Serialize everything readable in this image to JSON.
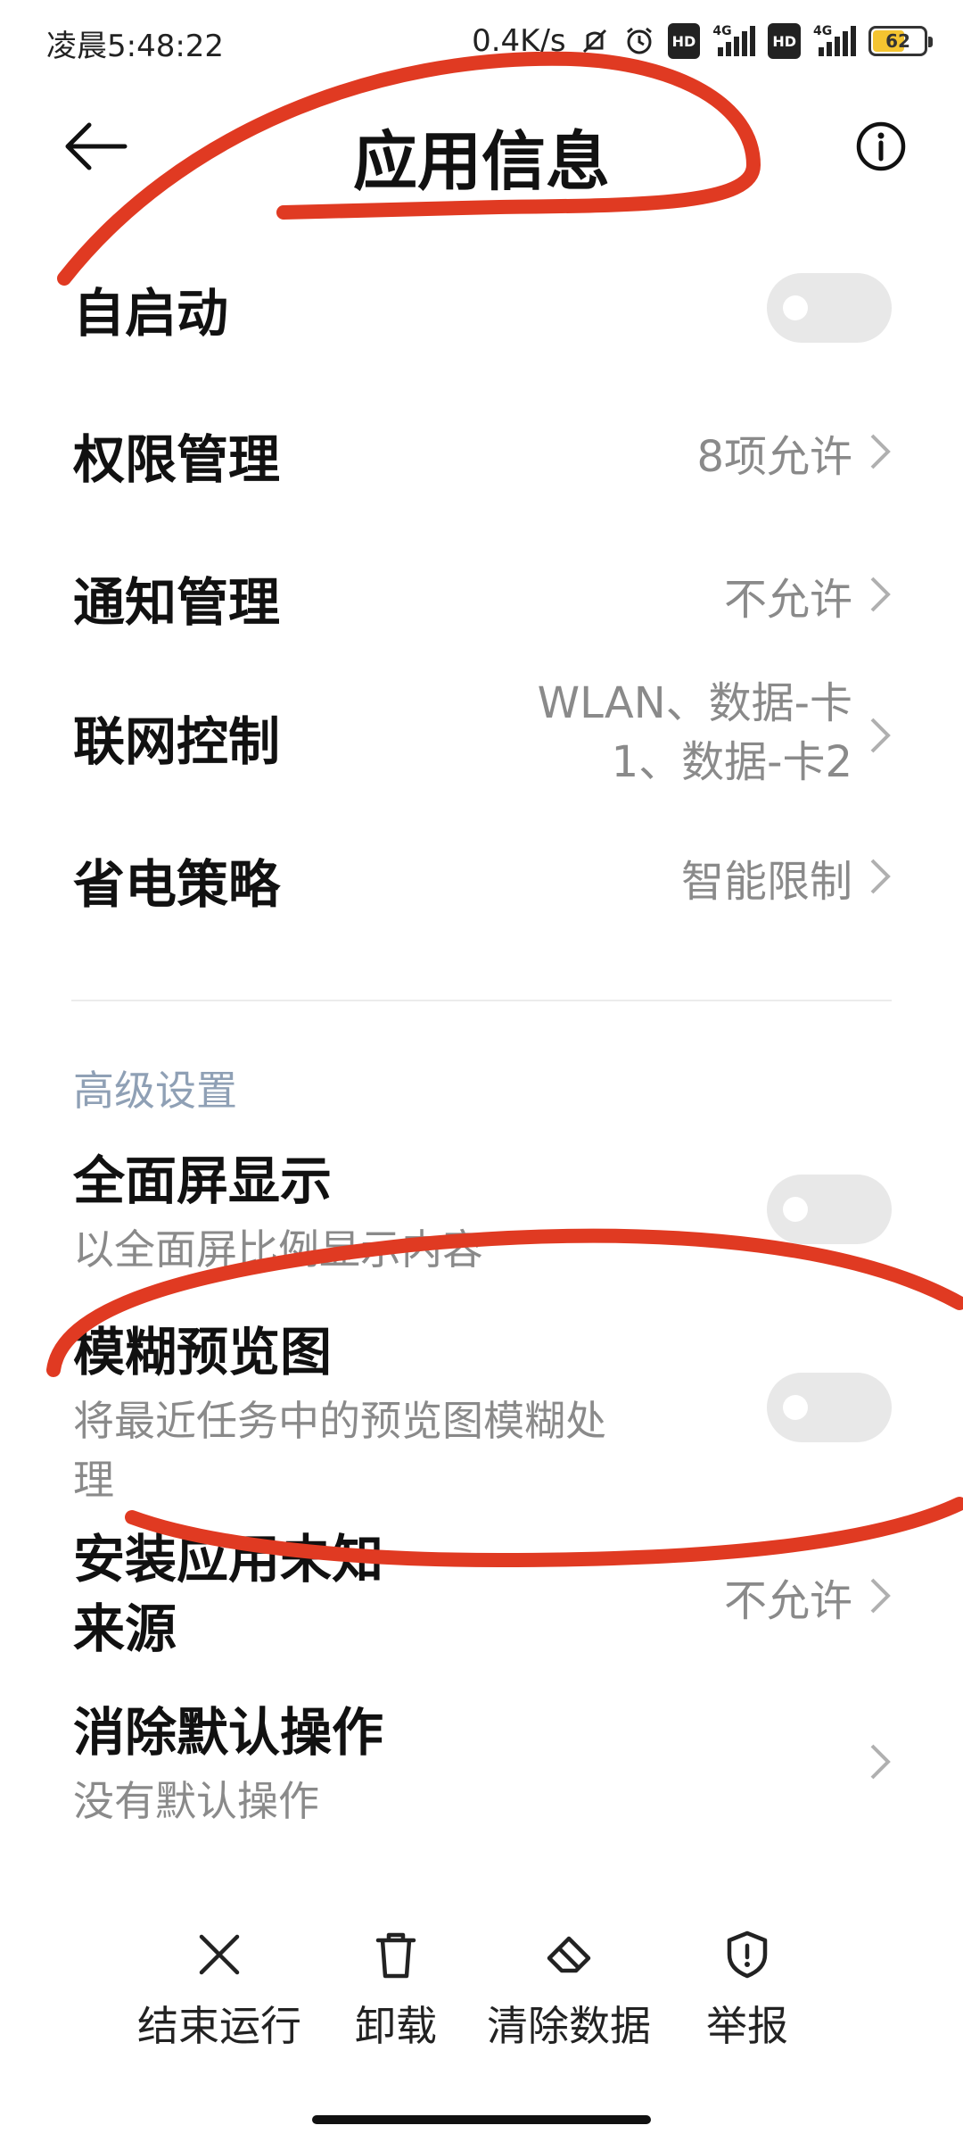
{
  "status_bar": {
    "time": "凌晨5:48:22",
    "net_speed": "0.4K/s",
    "signal_label_1": "4G",
    "signal_label_2": "4G",
    "hd_label": "HD",
    "battery": "62"
  },
  "header": {
    "title": "应用信息"
  },
  "rows": {
    "autostart": {
      "title": "自启动",
      "enabled": false
    },
    "permissions": {
      "title": "权限管理",
      "value": "8项允许"
    },
    "notifications": {
      "title": "通知管理",
      "value": "不允许"
    },
    "network": {
      "title": "联网控制",
      "value_line1": "WLAN、数据-卡",
      "value_line2": "1、数据-卡2"
    },
    "battery_saver": {
      "title": "省电策略",
      "value": "智能限制"
    }
  },
  "advanced": {
    "section_title": "高级设置",
    "fullscreen": {
      "title": "全面屏显示",
      "subtitle": "以全面屏比例显示内容",
      "enabled": false
    },
    "blur_preview": {
      "title": "模糊预览图",
      "subtitle_line1": "将最近任务中的预览图模糊处",
      "subtitle_line2": "理",
      "enabled": false
    },
    "unknown_sources": {
      "title_line1": "安装应用未知",
      "title_line2": "来源",
      "value": "不允许"
    },
    "clear_defaults": {
      "title": "消除默认操作",
      "subtitle": "没有默认操作"
    }
  },
  "bottom_actions": {
    "force_stop": "结束运行",
    "uninstall": "卸载",
    "clear_data": "清除数据",
    "report": "举报"
  },
  "colors": {
    "annotation_stroke": "#e03a22",
    "section_header": "#8fa0b5",
    "toggle_off": "#e8e8e8"
  }
}
